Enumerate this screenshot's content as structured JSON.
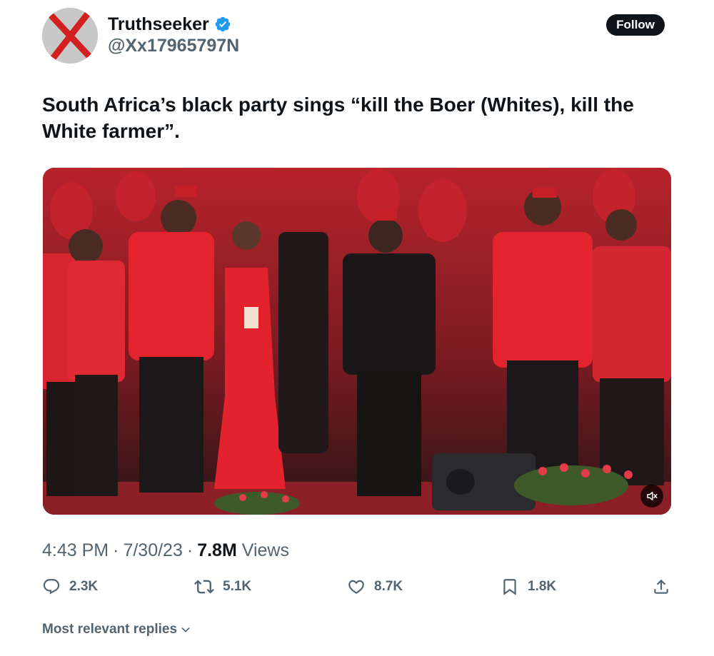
{
  "author": {
    "display_name": "Truthseeker",
    "handle": "@Xx17965797N",
    "verified": true,
    "avatar_icon": "red-x-avatar-icon"
  },
  "follow_label": "Follow",
  "tweet": {
    "text": "South Africa’s black party sings “kill the Boer (Whites), kill the White farmer”.",
    "media_type": "video",
    "muted": true
  },
  "meta": {
    "time": "4:43 PM",
    "date": "7/30/23",
    "views_count": "7.8M",
    "views_label": "Views",
    "separator": "·"
  },
  "actions": {
    "replies": "2.3K",
    "reposts": "5.1K",
    "likes": "8.7K",
    "bookmarks": "1.8K"
  },
  "replies_sort_label": "Most relevant replies",
  "colors": {
    "text_primary": "#0f1419",
    "text_secondary": "#536471",
    "verified_blue": "#1d9bf0",
    "follow_bg": "#0f1419"
  }
}
